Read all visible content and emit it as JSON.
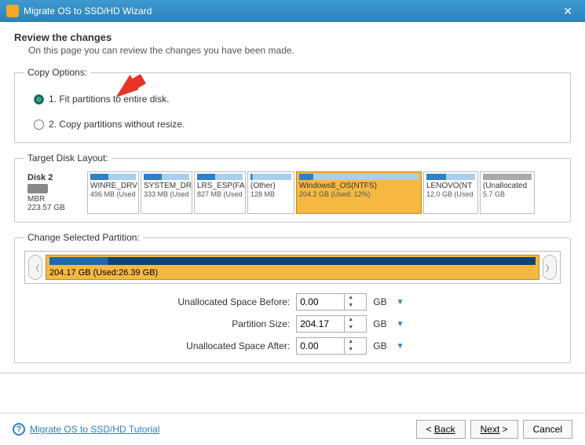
{
  "titlebar": {
    "title": "Migrate OS to SSD/HD Wizard"
  },
  "page": {
    "heading": "Review the changes",
    "subheading": "On this page you can review the changes you have been made."
  },
  "copy_options": {
    "legend": "Copy Options:",
    "opt1": "1. Fit partitions to entire disk.",
    "opt2": "2. Copy partitions without resize.",
    "selected": 1
  },
  "target_layout": {
    "legend": "Target Disk Layout:",
    "disk": {
      "name": "Disk 2",
      "type": "MBR",
      "size": "223.57 GB"
    },
    "partitions": [
      {
        "label": "WINRE_DRV",
        "size": "496 MB (Used",
        "used_pct": 40,
        "selected": false
      },
      {
        "label": "SYSTEM_DR",
        "size": "333 MB (Used",
        "used_pct": 40,
        "selected": false
      },
      {
        "label": "LRS_ESP(FA",
        "size": "827 MB (Used",
        "used_pct": 40,
        "selected": false
      },
      {
        "label": "(Other)",
        "size": "128 MB",
        "used_pct": 5,
        "selected": false
      },
      {
        "label": "Windows8_OS(NTFS)",
        "size": "204.2 GB (Used: 12%)",
        "used_pct": 12,
        "selected": true
      },
      {
        "label": "LENOVO(NT",
        "size": "12.0 GB (Used",
        "used_pct": 40,
        "selected": false
      },
      {
        "label": "(Unallocated",
        "size": "5.7 GB",
        "used_pct": 0,
        "selected": false,
        "unalloc": true
      }
    ]
  },
  "change_partition": {
    "legend": "Change Selected Partition:",
    "big_label": "204.17 GB (Used:26.39 GB)"
  },
  "controls": {
    "before_label": "Unallocated Space Before:",
    "before_value": "0.00",
    "size_label": "Partition Size:",
    "size_value": "204.17",
    "after_label": "Unallocated Space After:",
    "after_value": "0.00",
    "unit": "GB"
  },
  "footer": {
    "tutorial": "Migrate OS to SSD/HD Tutorial",
    "back": "Back",
    "next": "Next",
    "cancel": "Cancel"
  }
}
